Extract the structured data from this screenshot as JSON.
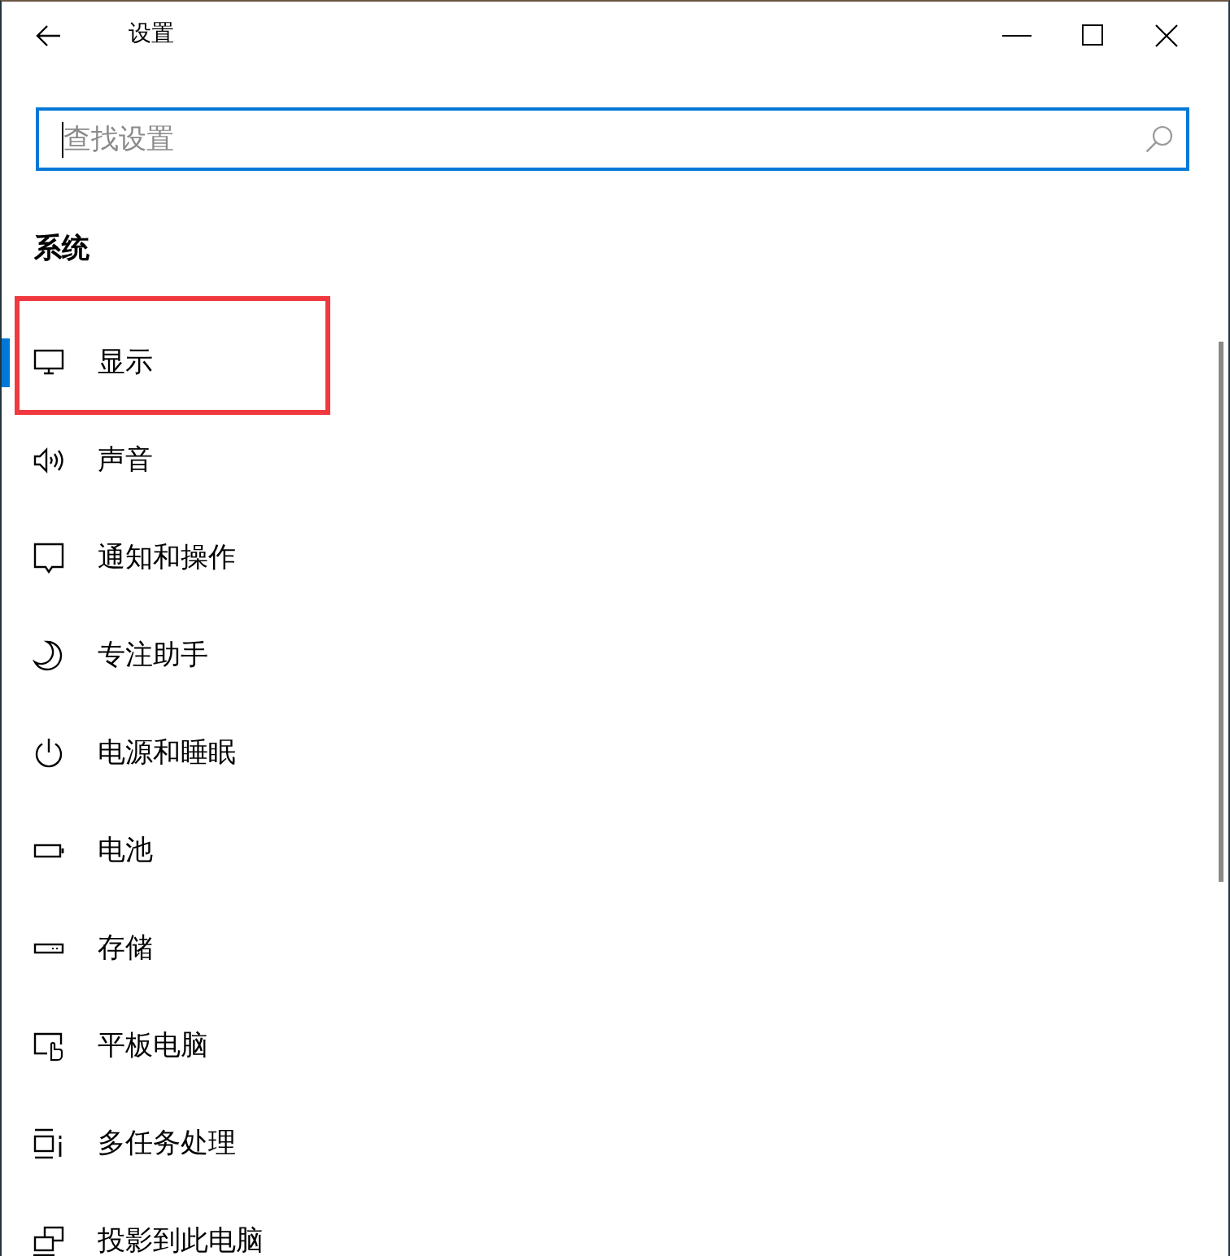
{
  "window": {
    "title": "设置"
  },
  "search": {
    "placeholder": "查找设置",
    "focused": true
  },
  "sidebar": {
    "section_title": "系统",
    "items": [
      {
        "label": "显示",
        "selected": true,
        "highlighted": true
      },
      {
        "label": "声音",
        "selected": false,
        "highlighted": false
      },
      {
        "label": "通知和操作",
        "selected": false,
        "highlighted": false
      },
      {
        "label": "专注助手",
        "selected": false,
        "highlighted": false
      },
      {
        "label": "电源和睡眠",
        "selected": false,
        "highlighted": false
      },
      {
        "label": "电池",
        "selected": false,
        "highlighted": false
      },
      {
        "label": "存储",
        "selected": false,
        "highlighted": false
      },
      {
        "label": "平板电脑",
        "selected": false,
        "highlighted": false
      },
      {
        "label": "多任务处理",
        "selected": false,
        "highlighted": false
      },
      {
        "label": "投影到此电脑",
        "selected": false,
        "highlighted": false
      }
    ]
  }
}
